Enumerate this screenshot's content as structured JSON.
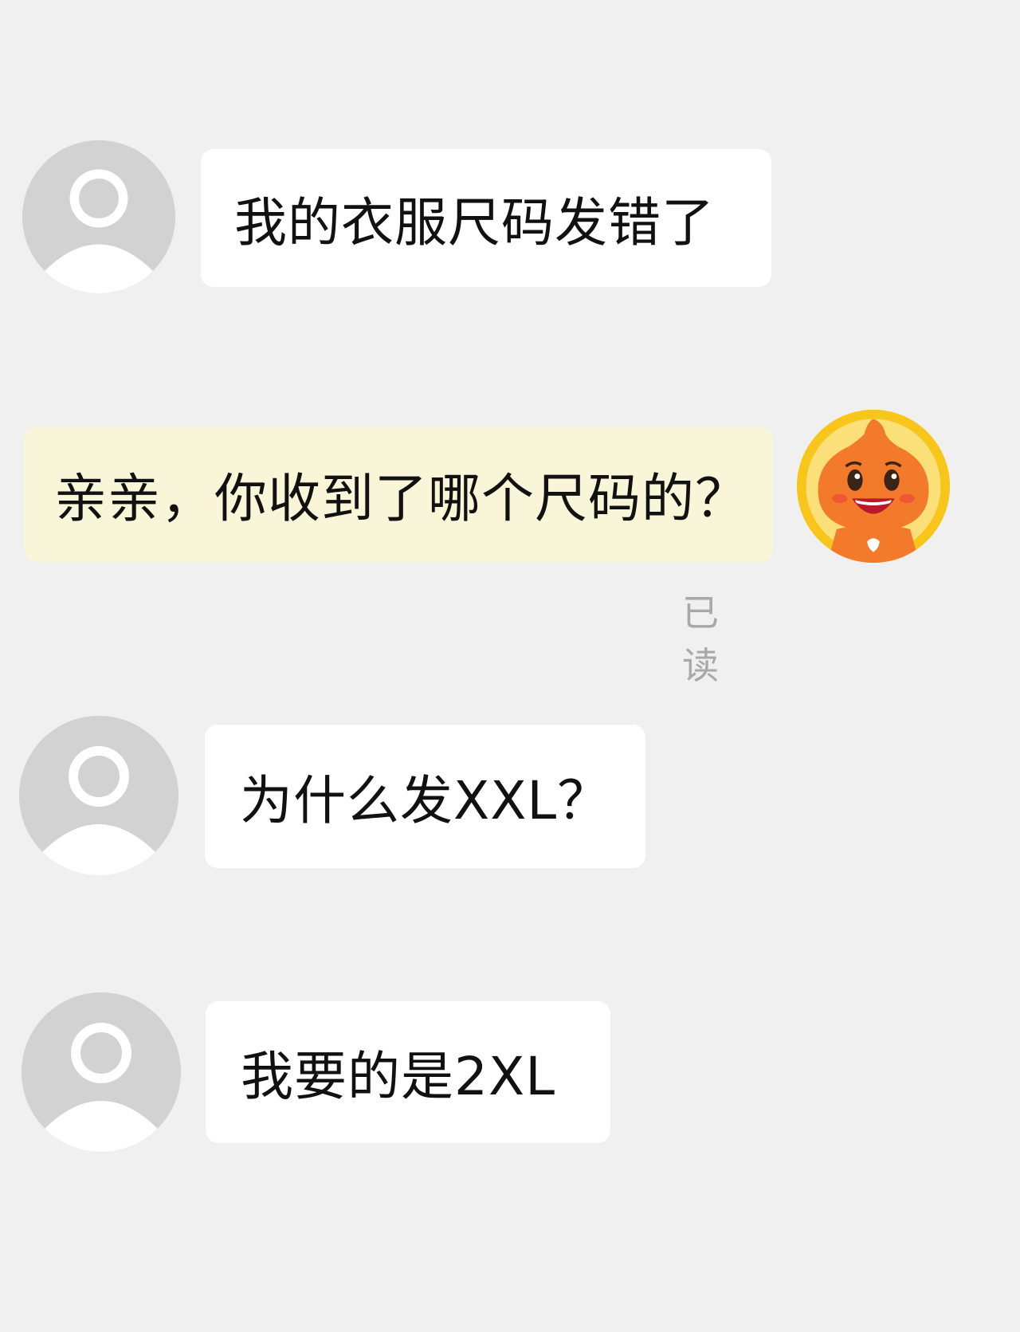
{
  "conversation": {
    "messages": [
      {
        "sender": "customer",
        "avatar_icon": "default-user-avatar-icon",
        "text": "我的衣服尺码发错了"
      },
      {
        "sender": "agent",
        "avatar_icon": "orange-mascot-avatar-icon",
        "text": "亲亲，你收到了哪个尺码的？",
        "status": "已读"
      },
      {
        "sender": "customer",
        "avatar_icon": "default-user-avatar-icon",
        "text": "为什么发XXL？"
      },
      {
        "sender": "customer",
        "avatar_icon": "default-user-avatar-icon",
        "text": "我要的是2XL"
      }
    ]
  },
  "colors": {
    "background": "#f0f0f0",
    "incoming_bubble": "#ffffff",
    "outgoing_bubble": "#f9f5d8",
    "default_avatar": "#d2d2d2",
    "read_status": "#a8a8a8",
    "mascot_orange": "#f27a2a",
    "mascot_ring": "#f8c61a"
  }
}
